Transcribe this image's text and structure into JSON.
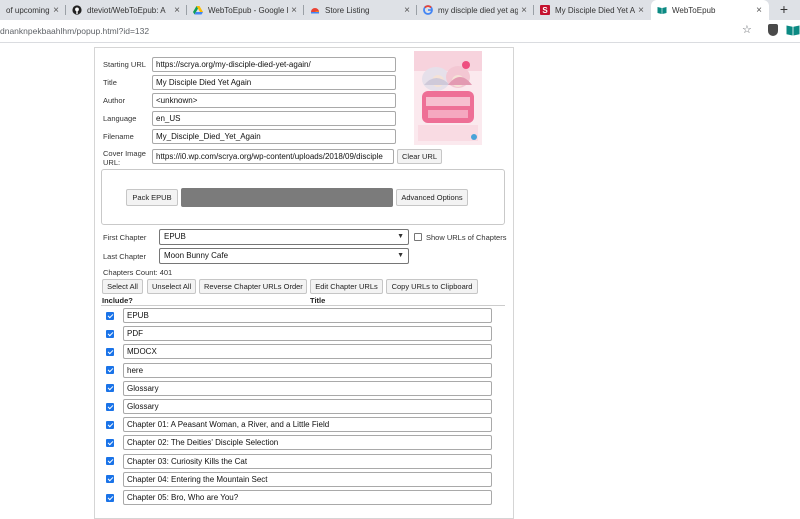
{
  "browser": {
    "tabs": [
      {
        "label": "of upcoming cl",
        "icon": "none-icon",
        "active": false
      },
      {
        "label": "dteviot/WebToEpub: A",
        "icon": "github-icon",
        "active": false
      },
      {
        "label": "WebToEpub - Google D",
        "icon": "google-drive-icon",
        "active": false
      },
      {
        "label": "Store Listing",
        "icon": "chrome-store-icon",
        "active": false
      },
      {
        "label": "my disciple died yet ag",
        "icon": "google-icon",
        "active": false
      },
      {
        "label": "My Disciple Died Yet A",
        "icon": "scrya-icon",
        "active": false
      },
      {
        "label": "WebToEpub",
        "icon": "book-icon",
        "active": true
      }
    ],
    "new_tab": "+",
    "close_glyph": "×",
    "url": "dnanknpekbaahlhm/popup.html?id=132"
  },
  "form": {
    "starting_url_label": "Starting URL",
    "starting_url": "https://scrya.org/my-disciple-died-yet-again/",
    "title_label": "Title",
    "title": "My Disciple Died Yet Again",
    "author_label": "Author",
    "author": "<unknown>",
    "language_label": "Language",
    "language": "en_US",
    "filename_label": "Filename",
    "filename": "My_Disciple_Died_Yet_Again",
    "cover_label_1": "Cover Image",
    "cover_label_2": "URL:",
    "cover_url": "https://i0.wp.com/scrya.org/wp-content/uploads/2018/09/disciple",
    "clear_url": "Clear URL"
  },
  "actions": {
    "pack_epub": "Pack EPUB",
    "advanced_options": "Advanced Options",
    "progress": 1.0
  },
  "chapters": {
    "first_label": "First Chapter",
    "first_value": "EPUB",
    "last_label": "Last Chapter",
    "last_value": "Moon Bunny Cafe",
    "show_urls_label": "Show URLs of Chapters",
    "show_urls_checked": false,
    "count_text": "Chapters Count: 401",
    "select_all": "Select All",
    "unselect_all": "Unselect All",
    "reverse": "Reverse Chapter URLs Order",
    "edit": "Edit Chapter URLs",
    "copy": "Copy URLs to Clipboard",
    "col_include": "Include?",
    "col_title": "Title",
    "rows": [
      {
        "title": "EPUB",
        "checked": true
      },
      {
        "title": "PDF",
        "checked": true
      },
      {
        "title": "MDOCX",
        "checked": true
      },
      {
        "title": "here",
        "checked": true
      },
      {
        "title": "Glossary",
        "checked": true
      },
      {
        "title": "Glossary",
        "checked": true
      },
      {
        "title": "Chapter 01: A Peasant Woman, a River, and a Little Field",
        "checked": true
      },
      {
        "title": "Chapter 02: The Deities' Disciple Selection",
        "checked": true
      },
      {
        "title": "Chapter 03: Curiosity Kills the Cat",
        "checked": true
      },
      {
        "title": "Chapter 04: Entering the Mountain Sect",
        "checked": true
      },
      {
        "title": "Chapter 05: Bro, Who are You?",
        "checked": true
      }
    ]
  }
}
